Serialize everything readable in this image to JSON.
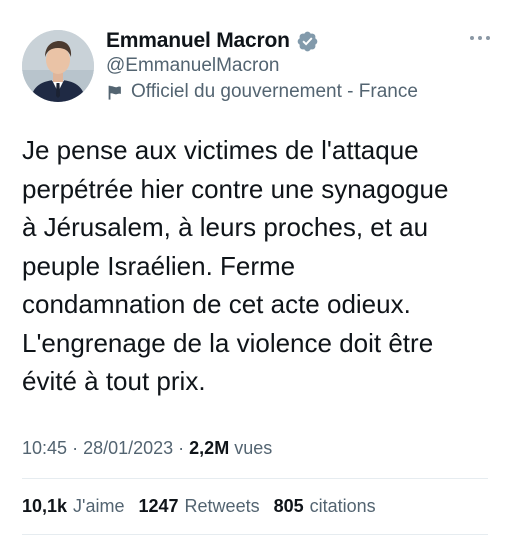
{
  "author": {
    "display_name": "Emmanuel Macron",
    "handle": "@EmmanuelMacron",
    "affiliation_label": "Officiel du gouvernement - France",
    "verified_badge_color": "#829aab"
  },
  "tweet": {
    "text_lines": [
      "Je pense aux victimes de l'attaque",
      "perpétrée hier contre une synagogue",
      "à Jérusalem, à leurs proches, et au",
      "peuple Israélien. Ferme",
      "condamnation de cet acte odieux.",
      "L'engrenage de la violence doit être",
      "évité à tout prix."
    ],
    "time": "10:45",
    "date": "28/01/2023",
    "views_count": "2,2M",
    "views_label": "vues"
  },
  "stats": {
    "likes_count": "10,1k",
    "likes_label": "J'aime",
    "retweets_count": "1247",
    "retweets_label": "Retweets",
    "quotes_count": "805",
    "quotes_label": "citations"
  },
  "colors": {
    "secondary_text": "#536471",
    "divider": "#e6ecf0"
  }
}
